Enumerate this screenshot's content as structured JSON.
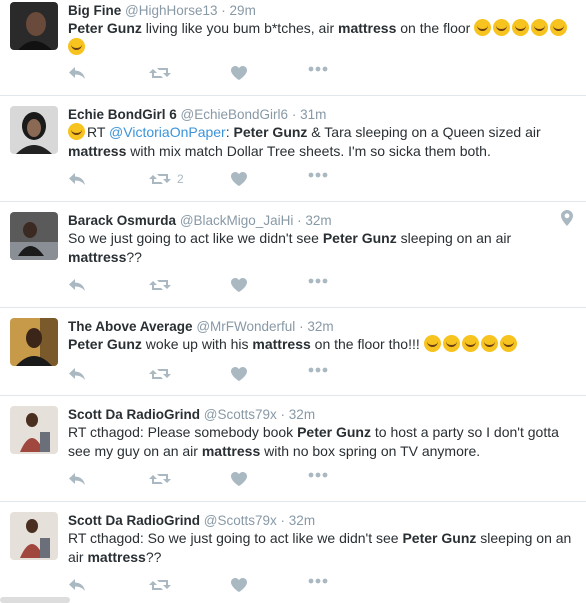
{
  "tweets": [
    {
      "name": "Big Fine",
      "handle": "@HighHorse13",
      "time": "29m",
      "segments": [
        {
          "t": "Peter Gunz",
          "s": "bold"
        },
        {
          "t": " living like you bum b*tches, air ",
          "s": "plain"
        },
        {
          "t": "mattress",
          "s": "bold"
        },
        {
          "t": " on the floor ",
          "s": "plain"
        },
        {
          "t": "😂",
          "s": "emoji"
        },
        {
          "t": "😂",
          "s": "emoji"
        },
        {
          "t": "😂",
          "s": "emoji"
        },
        {
          "t": "😂",
          "s": "emoji"
        },
        {
          "t": "😂",
          "s": "emoji"
        },
        {
          "t": "😂",
          "s": "emoji"
        }
      ],
      "retweet_count": ""
    },
    {
      "name": "Echie BondGirl 6",
      "handle": "@EchieBondGirl6",
      "time": "31m",
      "segments": [
        {
          "t": "😩",
          "s": "emoji"
        },
        {
          "t": "RT ",
          "s": "plain"
        },
        {
          "t": "@VictoriaOnPaper",
          "s": "mention"
        },
        {
          "t": ": ",
          "s": "plain"
        },
        {
          "t": "Peter Gunz",
          "s": "bold"
        },
        {
          "t": " & Tara sleeping on a Queen sized air ",
          "s": "plain"
        },
        {
          "t": "mattress",
          "s": "bold"
        },
        {
          "t": " with mix match Dollar Tree sheets. I'm so sicka them both.",
          "s": "plain"
        }
      ],
      "retweet_count": "2"
    },
    {
      "name": "Barack Osmurda",
      "handle": "@BlackMigo_JaiHi",
      "time": "32m",
      "segments": [
        {
          "t": "So we just going to act like we didn't see ",
          "s": "plain"
        },
        {
          "t": "Peter Gunz",
          "s": "bold"
        },
        {
          "t": " sleeping on an air ",
          "s": "plain"
        },
        {
          "t": "mattress",
          "s": "bold"
        },
        {
          "t": "??",
          "s": "plain"
        }
      ],
      "retweet_count": "",
      "has_location": true
    },
    {
      "name": "The Above Average",
      "handle": "@MrFWonderful",
      "time": "32m",
      "segments": [
        {
          "t": "Peter Gunz",
          "s": "bold"
        },
        {
          "t": " woke up with his ",
          "s": "plain"
        },
        {
          "t": "mattress",
          "s": "bold"
        },
        {
          "t": " on the floor tho!!! ",
          "s": "plain"
        },
        {
          "t": "😂",
          "s": "emoji"
        },
        {
          "t": "😂",
          "s": "emoji"
        },
        {
          "t": "😂",
          "s": "emoji"
        },
        {
          "t": "😂",
          "s": "emoji"
        },
        {
          "t": "😂",
          "s": "emoji"
        }
      ],
      "retweet_count": ""
    },
    {
      "name": "Scott Da RadioGrind",
      "handle": "@Scotts79x",
      "time": "32m",
      "segments": [
        {
          "t": "RT cthagod: Please somebody book ",
          "s": "plain"
        },
        {
          "t": "Peter Gunz",
          "s": "bold"
        },
        {
          "t": " to host a party so I don't gotta see my guy on an air ",
          "s": "plain"
        },
        {
          "t": "mattress",
          "s": "bold"
        },
        {
          "t": " with no box spring on TV anymore.",
          "s": "plain"
        }
      ],
      "retweet_count": ""
    },
    {
      "name": "Scott Da RadioGrind",
      "handle": "@Scotts79x",
      "time": "32m",
      "segments": [
        {
          "t": "RT cthagod: So we just going to act like we didn't see ",
          "s": "plain"
        },
        {
          "t": "Peter Gunz",
          "s": "bold"
        },
        {
          "t": " sleeping on an air ",
          "s": "plain"
        },
        {
          "t": "mattress",
          "s": "bold"
        },
        {
          "t": "??",
          "s": "plain"
        }
      ],
      "retweet_count": ""
    }
  ],
  "separator_dot": "·",
  "icons": [
    "reply-icon",
    "retweet-icon",
    "like-icon",
    "more-icon",
    "location-icon",
    "emoji-tears-of-joy",
    "emoji-weary-face"
  ],
  "colors": {
    "mention": "#3b94d9",
    "meta": "#8899a6",
    "action": "#aab8c2",
    "emoji": "#f7c31f"
  }
}
